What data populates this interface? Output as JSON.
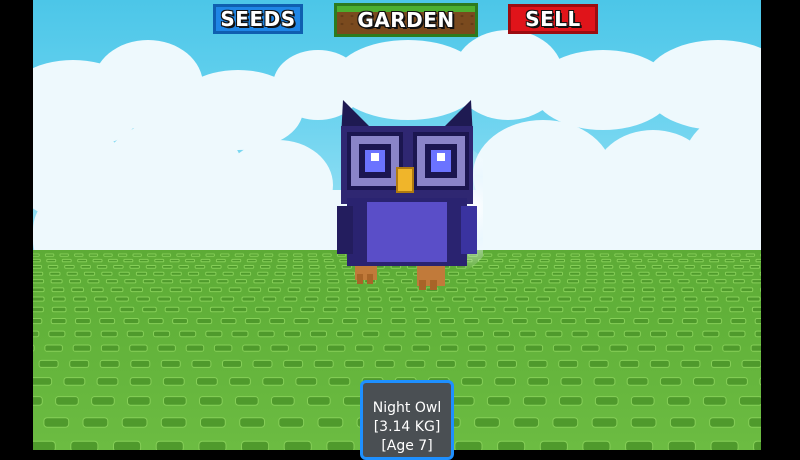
{
  "top_bar": {
    "seeds_label": "SEEDS",
    "garden_label": "GARDEN",
    "sell_label": "SELL"
  },
  "pet_tooltip": {
    "name": "Night Owl",
    "weight": "[3.14 KG]",
    "age": "[Age 7]"
  },
  "colors": {
    "seeds": "#1f86e6",
    "garden_grass": "#4caf2f",
    "garden_dirt": "#7a4a1e",
    "sell": "#e0141a",
    "tooltip_border": "#1e90ff",
    "owl_body": "#3b2f8f",
    "sky": "#62d0ee",
    "ground": "#62b23a"
  },
  "icons": {
    "pet": "night-owl-pet"
  }
}
